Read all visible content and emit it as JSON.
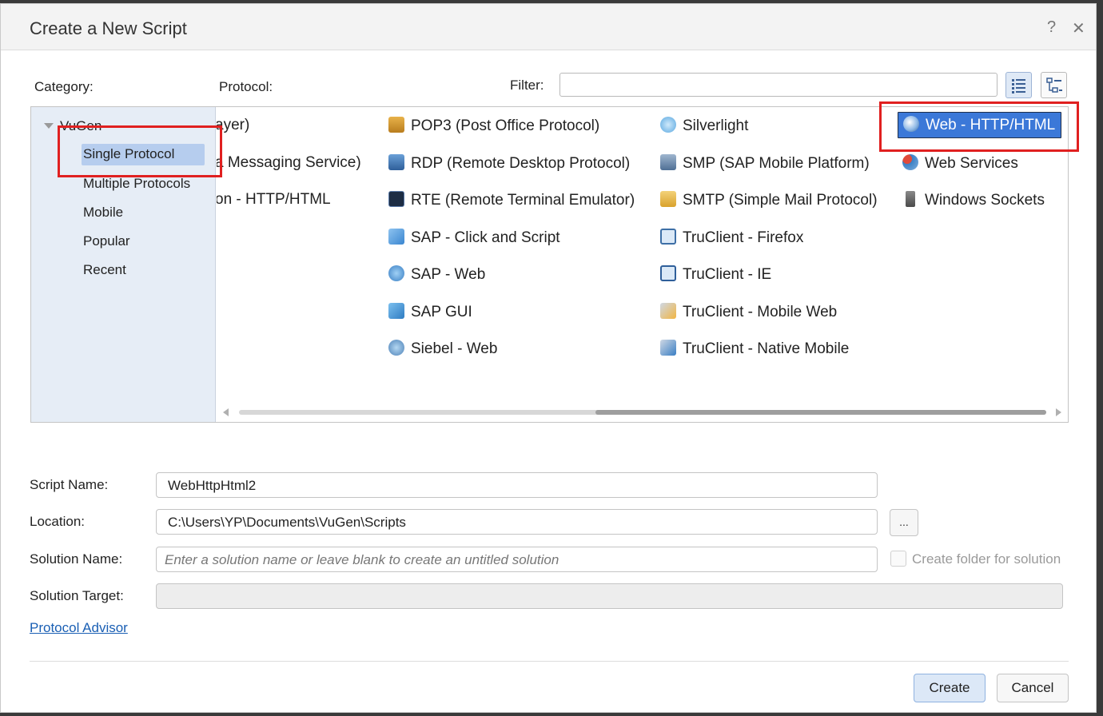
{
  "window": {
    "title": "Create a New Script",
    "help_label": "?",
    "close_label": "✕"
  },
  "labels": {
    "category": "Category:",
    "protocol": "Protocol:",
    "filter": "Filter:"
  },
  "filter": {
    "value": ""
  },
  "tree": {
    "root": "VuGen",
    "items": [
      "Single Protocol",
      "Multiple Protocols",
      "Mobile",
      "Popular",
      "Recent"
    ]
  },
  "protocols": {
    "col0": [
      "ayer)",
      "a Messaging Service)",
      "on - HTTP/HTML"
    ],
    "col1": [
      "POP3 (Post Office Protocol)",
      "RDP (Remote Desktop Protocol)",
      "RTE (Remote Terminal Emulator)",
      "SAP - Click and Script",
      "SAP - Web",
      "SAP GUI",
      "Siebel - Web"
    ],
    "col2": [
      "Silverlight",
      "SMP (SAP Mobile Platform)",
      "SMTP (Simple Mail Protocol)",
      "TruClient - Firefox",
      "TruClient - IE",
      "TruClient - Mobile Web",
      "TruClient - Native Mobile"
    ],
    "col3": [
      "Web - HTTP/HTML",
      "Web Services",
      "Windows Sockets"
    ]
  },
  "icons": {
    "col1": [
      "pop3-icon",
      "rdp-icon",
      "rte-icon",
      "sap-click-icon",
      "sap-web-icon",
      "sap-gui-icon",
      "siebel-icon"
    ],
    "col2": [
      "silverlight-icon",
      "smp-icon",
      "smtp-icon",
      "truclient-firefox-icon",
      "truclient-ie-icon",
      "truclient-mobile-web-icon",
      "truclient-native-mobile-icon"
    ],
    "col3": [
      "web-globe-icon",
      "web-services-icon",
      "windows-sockets-icon"
    ]
  },
  "form": {
    "script_name_label": "Script Name:",
    "script_name": "WebHttpHtml2",
    "location_label": "Location:",
    "location": "C:\\Users\\YP\\Documents\\VuGen\\Scripts",
    "browse_label": "...",
    "solution_name_label": "Solution Name:",
    "solution_name_placeholder": "Enter a solution name or leave blank to create an untitled solution",
    "create_folder_label": "Create folder for solution",
    "solution_target_label": "Solution Target:",
    "solution_target": ""
  },
  "links": {
    "protocol_advisor": "Protocol Advisor"
  },
  "buttons": {
    "create": "Create",
    "cancel": "Cancel"
  },
  "colors": {
    "selection": "#3b78d8",
    "highlight_box": "#e02020",
    "tree_bg": "#e6edf6"
  }
}
